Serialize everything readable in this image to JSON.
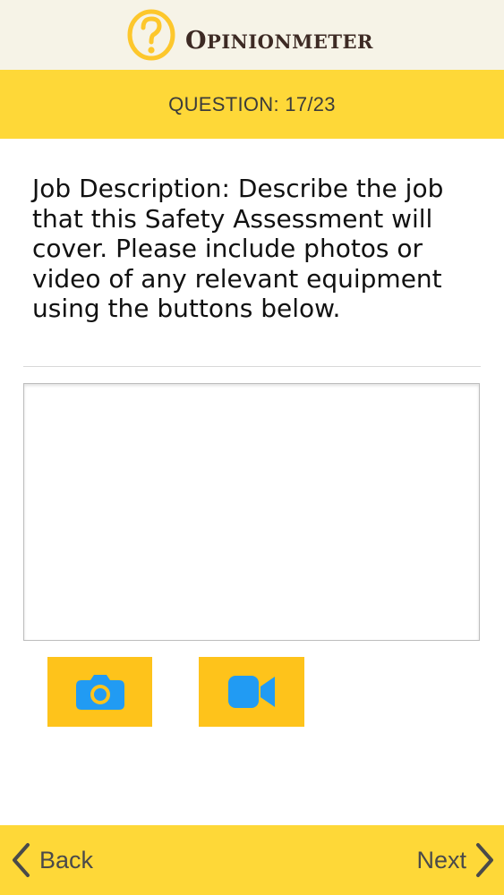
{
  "brand": {
    "name_initial": "O",
    "name_rest": "PINIONMETER",
    "logo_icon": "question-mark-circle-icon",
    "logo_color": "#fdc72c"
  },
  "question_bar": {
    "counter": "QUESTION: 17/23",
    "background": "#fed838"
  },
  "question": {
    "text": "Job Description: Describe the job that this Safety Assessment will cover. Please include photos or video of any relevant equipment using the buttons below."
  },
  "answer": {
    "value": "",
    "placeholder": ""
  },
  "media_buttons": {
    "photo_icon": "camera-icon",
    "video_icon": "video-camera-icon",
    "button_color": "#fec31b",
    "icon_color": "#219bf3"
  },
  "navigation": {
    "back_label": "Back",
    "next_label": "Next",
    "back_icon": "chevron-left-icon",
    "next_icon": "chevron-right-icon"
  }
}
